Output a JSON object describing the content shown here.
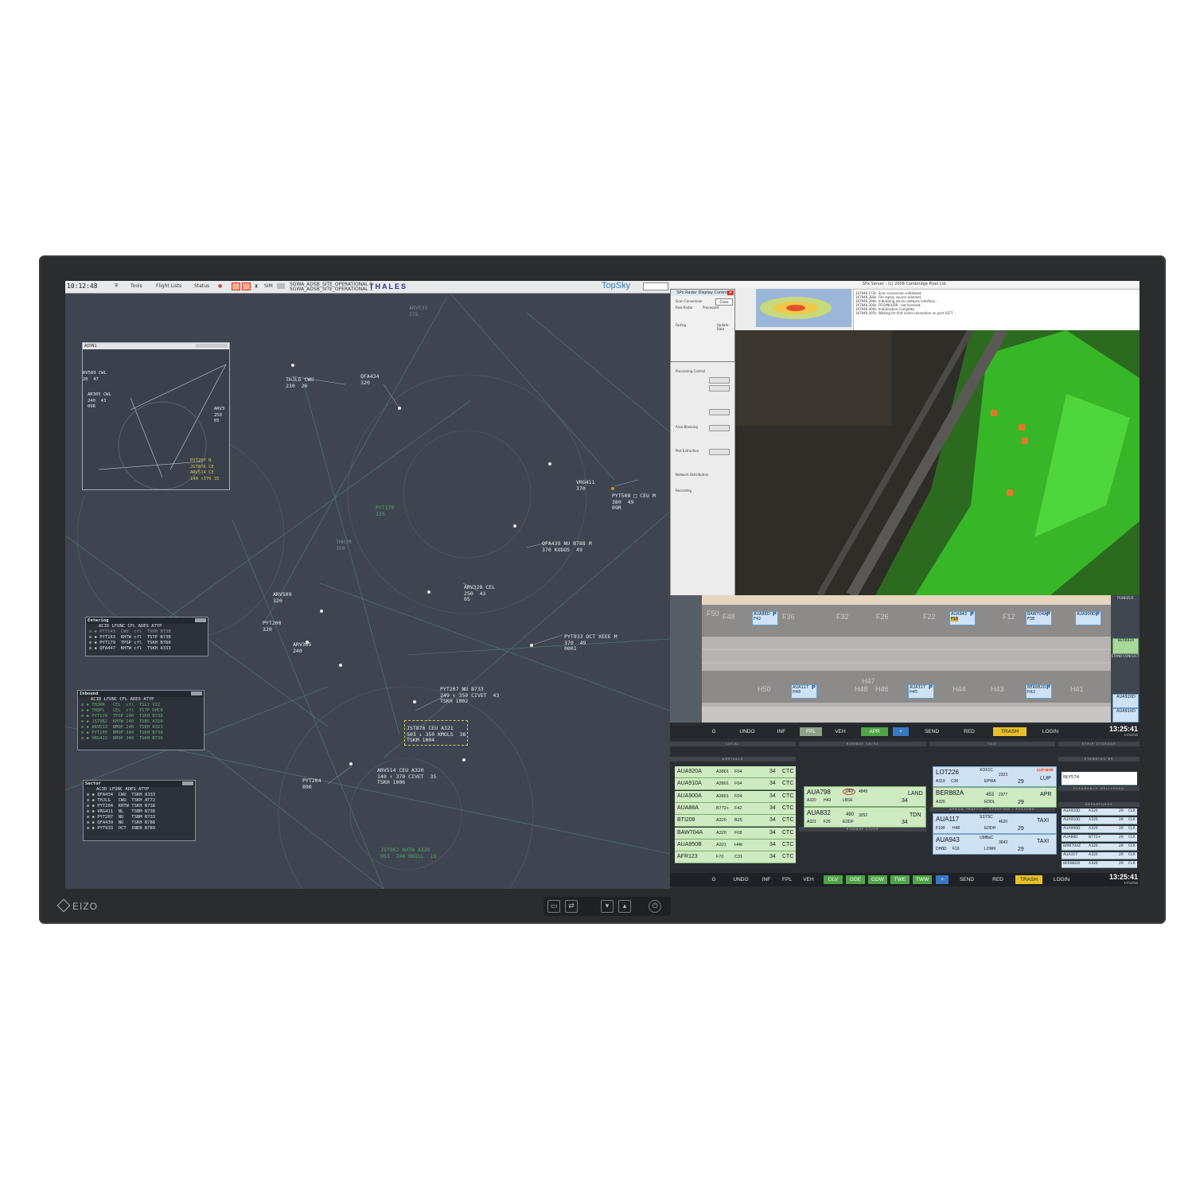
{
  "brand": {
    "name": "EIZO"
  },
  "radar": {
    "clock": "10:12:48",
    "menu": [
      "Tools",
      "Flight Lists",
      "Status"
    ],
    "sim": "SIM",
    "site_line1": "SGWA_ADSB_SITE_OPERATIONAL 1",
    "site_line2": "SGWA_ADSB_SITE_OPERATIONAL 1",
    "thales": "THALES",
    "topsky": "TopSky",
    "adin_title": "ADIN1",
    "labels": {
      "arv533": "ARV533\n275",
      "thjlg": "THJLG CWU\n230  26",
      "qfa434": "QFA434\n320",
      "vrg411": "VRG411\n370",
      "pyt508": "PYT508 □ CEU M\n380  49\n09R",
      "qfa439": "QFA439 NU B788 M\n370 KUDOS  49",
      "arv328": "ARV328 CEL\n250  43\n05",
      "arv509": "ARV509\n320",
      "pyt200": "PYT200\n320",
      "arv305": "ARV305\n240",
      "pyt933": "PYT933 OCT XEEE M\n370  49\n0001",
      "pyt207": "PYT207 NU B733\n249 ↑ 350 CIVET  43\nTSKH 1002",
      "jst876": "JST876 CEU A321\n503 ↓ 350 KMOLS  38\nTSKM 1004",
      "pyt204": "PYT204\n090",
      "arv514": "ARV514 CEU A320\n140 ↑ 370 CIVET  35\nTSKH 1006",
      "jst962": "JST962 KHTW A320\n053  240 KWILL  15",
      "pyt170": "PYT170\n235",
      "thhjm": "THHJM\n350",
      "adin_rv509": "RV509 CWL\n20  47",
      "adin_ar305": "AR305 CWL\n240  43\n09R",
      "adin_arv": "ARV3\n250\n05",
      "adin_pyt207": "PYT207 N\nJST876 CE\nARV514 CE\n140 ↑370 35"
    },
    "entering": {
      "title": "Entering",
      "header": "ACID      LFUNC CFL  ADES ATYP",
      "rows": [
        "≡ ▪ PYT143  CWU  cfl  TSKH B738",
        "≡ ▪ PYT163  KHTW cfl  TSTP B738",
        "≡ ▪ PYT179  TPSP cfl  TSKH B788",
        "≡ ▪ QFA447  KHTW cfl  TSKH A333"
      ]
    },
    "inbound": {
      "title": "Inbound",
      "header": "ACID      LFUNC CFL  ADES ATYP",
      "rows": [
        "≡ ▪ THJRK   CEL  cfl  TSLY V22",
        "≡ ▪ THQPL   CEL  cfl  TSTP DHC8",
        "≡ ▪ PYT170  TPSP 240  TSKH B738",
        "≡ ▪ JST962  KHTW 240  TSBS A310",
        "≡ ▪ ARV513  BMOP 240  TSKH A321",
        "≡ ▪ PYT205  BMOP 340  TSKH B738",
        "≡ ▪ VRG422  BMOP 340  TSKH B738"
      ]
    },
    "sector": {
      "title": "Sector",
      "header": "ACID      LFUNC ADES ATYP",
      "rows": [
        "≡ ▪ QFA434  CWU  TSKH A333",
        "≡ ▪ THJLG   CWU  TSKH AT72",
        "≡ ▪ PYT204  KHTW TSKH B738",
        "≡ ▪ VRG411  NL   TSBM B738",
        "≡ ▪ PYT207  NU   TSBM B733",
        "≡ ▪ QFA439  NU   TSKH B788",
        "≡ ▪ PYT933  OCT  XNEB B789"
      ]
    }
  },
  "sfx": {
    "server_title": "SPx Server - (c) 2008 Cambridge Pixel Ltd.",
    "control_title": "SPx Radar Display Control",
    "close": "Close",
    "log": [
      "167946.273s: Scan conversion initialised.",
      "167946.280s: File replay source selected.",
      "167946.290s: Initialising server network interface...",
      "167946.300s: FIFO/NI/UDP - not licensed.",
      "167946.400s: Initialisation Complete.",
      "167946.405s: Waiting for first client connection on port 4377..."
    ],
    "controls": [
      "Scan Conversion",
      "Raw Radar",
      "Processed",
      "Fading",
      "Update Rate",
      "Processing Control",
      "Area Blanking",
      "Plot Extraction",
      "Network Distribution",
      "Recording"
    ]
  },
  "apron": {
    "stands_top": [
      "F50",
      "F48",
      "F36",
      "F32",
      "F26",
      "F22",
      "F12"
    ],
    "stands_bottom": [
      "H50",
      "H48",
      "H47",
      "H46",
      "H44",
      "H43",
      "H41"
    ],
    "transfer": "TRANSFER",
    "stand_conflict": "STAND CONFLICT",
    "chips": {
      "c1": "AUA88D",
      "c2": "AUA943",
      "c3": "BAW704A",
      "c4": "AUA900D",
      "c5": "AUA117",
      "c6": "AUA317",
      "c7": "BER882D",
      "c8": "BER882A",
      "c9": "AUA920D",
      "c10": "AUA910D"
    },
    "chip_stands": {
      "c1": "F42",
      "c2": "F16",
      "c3": "F08",
      "c4": "",
      "c5": "H48",
      "c6": "H45",
      "c7": "H42"
    }
  },
  "toolbar_top": [
    "G",
    "UNDO",
    "INF",
    "FPL",
    "VEH",
    "APR",
    "+",
    "SEND",
    "RED",
    "TRASH",
    "LOGIN"
  ],
  "toolbar_bottom": [
    "G",
    "UNDO",
    "INF",
    "FPL",
    "VEH",
    "DLV",
    "GDE",
    "GDW",
    "TWE",
    "TWW",
    "+",
    "SEND",
    "RED",
    "TRASH",
    "LOGIN"
  ],
  "time": {
    "value": "13:25:41",
    "date": "17/12/15"
  },
  "sections": {
    "local": "LOCAL",
    "runway1": "RUNWAY 16/34",
    "taxi": "TAXI",
    "strip_storage": "STRIP STORAGE",
    "arrivals": "ARRIVALS",
    "standing_by": "STANDING BY",
    "clearance_delivered": "CLEARANCE DELIVERED",
    "apron_traffic": "APRON TRAFFIC - STARTING / PUSHING",
    "runway2": "RUNWAY 11/29",
    "departures": "DEPARTURES"
  },
  "arrivals": [
    [
      "AUA920A",
      "A3801",
      "F04",
      "34",
      "CTC"
    ],
    [
      "AUA910A",
      "A3801",
      "F04",
      "34",
      "CTC"
    ],
    [
      "AUA900A",
      "A3801",
      "F04",
      "34",
      "CTC"
    ],
    [
      "AUA88A",
      "B772+",
      "F42",
      "34",
      "CTC"
    ],
    [
      "BTI208",
      "A320",
      "B25",
      "34",
      "CTC"
    ],
    [
      "BAW704A",
      "A320",
      "F08",
      "34",
      "CTC"
    ],
    [
      "AUA950B",
      "A321",
      "H46",
      "34",
      "CTC"
    ],
    [
      "AFR123",
      "F70",
      "C31",
      "34",
      "CTC"
    ]
  ],
  "runway_strips": [
    {
      "acid": "AUA798",
      "alt": "240",
      "sq": "4845",
      "type": "A320",
      "stand": "H43",
      "sid": "LBSF",
      "rw": "34",
      "act": "LAND"
    },
    {
      "acid": "AUA832",
      "alt": "490",
      "sq": "3252",
      "type": "A321",
      "stand": "F26",
      "sid": "EDDF",
      "rw": "34",
      "act": "TDN"
    }
  ],
  "taxi_strips": [
    {
      "acid": "LOT226",
      "reg": "XOX1C",
      "sq": "2323",
      "type": "A319",
      "stand": "C36",
      "dest": "EPWA",
      "rw": "29",
      "act": "LUP",
      "tag": "LUP+BAR"
    },
    {
      "acid": "BER882A",
      "sq": "2377",
      "alt": "453",
      "type": "A320",
      "dest": "EDDL",
      "rw": "29",
      "act": "APR"
    }
  ],
  "apron_strips": [
    {
      "acid": "AUA117",
      "reg": "SSTSC",
      "sq": "4620",
      "type": "F100",
      "stand": "H48",
      "dest": "EDDH",
      "rw": "29",
      "act": "TAXI"
    },
    {
      "acid": "AUA943",
      "reg": "UMBaC",
      "sq": "3643",
      "type": "DH8D",
      "stand": "F16",
      "dest": "LOWK",
      "rw": "29",
      "act": "TAXI"
    }
  ],
  "standing_by": [
    "NLY574"
  ],
  "departures": [
    [
      "AUA920D",
      "A320",
      "29",
      "CLR"
    ],
    [
      "AUA910D",
      "A320",
      "29",
      "CLR"
    ],
    [
      "AUA900D",
      "A320",
      "29",
      "CLR"
    ],
    [
      "AUA88D",
      "B772+",
      "29",
      "CLR"
    ],
    [
      "BAW704Z",
      "A320",
      "29",
      "CLR"
    ],
    [
      "AUA317",
      "A320",
      "29",
      "CLR"
    ],
    [
      "BER882D",
      "A320",
      "29",
      "CLR"
    ]
  ],
  "colors": {
    "radar_bg": "#3e4550",
    "strip_green": "#cdeac0",
    "strip_blue": "#cfe2f4",
    "accent_green": "#4fa547",
    "accent_yellow": "#e8c12a"
  }
}
